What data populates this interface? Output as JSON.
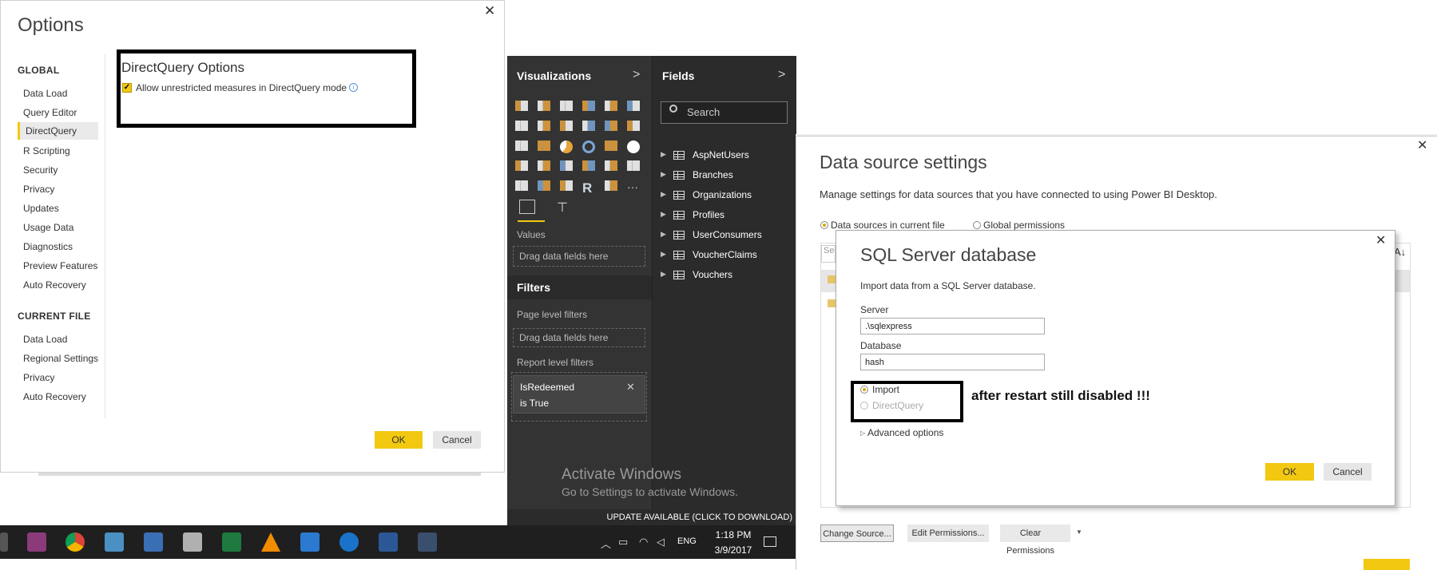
{
  "options_dialog": {
    "title": "Options",
    "global_heading": "GLOBAL",
    "global_items": [
      "Data Load",
      "Query Editor",
      "DirectQuery",
      "R Scripting",
      "Security",
      "Privacy",
      "Updates",
      "Usage Data",
      "Diagnostics",
      "Preview Features",
      "Auto Recovery"
    ],
    "active_item": "DirectQuery",
    "current_file_heading": "CURRENT FILE",
    "current_file_items": [
      "Data Load",
      "Regional Settings",
      "Privacy",
      "Auto Recovery"
    ],
    "section_title": "DirectQuery Options",
    "checkbox_label": "Allow unrestricted measures in DirectQuery mode",
    "checkbox_checked": true,
    "ok_label": "OK",
    "cancel_label": "Cancel"
  },
  "visualizations": {
    "title": "Visualizations",
    "values_label": "Values",
    "values_drop": "Drag data fields here"
  },
  "filters": {
    "title": "Filters",
    "page_level": "Page level filters",
    "page_drop": "Drag data fields here",
    "report_level": "Report level filters",
    "card_field": "IsRedeemed",
    "card_condition": "is True"
  },
  "fields": {
    "title": "Fields",
    "search_placeholder": "Search",
    "tables": [
      "AspNetUsers",
      "Branches",
      "Organizations",
      "Profiles",
      "UserConsumers",
      "VoucherClaims",
      "Vouchers"
    ]
  },
  "watermark": {
    "line1": "Activate Windows",
    "line2": "Go to Settings to activate Windows."
  },
  "update_bar": "UPDATE AVAILABLE (CLICK TO DOWNLOAD)",
  "taskbar": {
    "language": "ENG",
    "time": "1:18 PM",
    "date": "3/9/2017"
  },
  "data_source_settings": {
    "title": "Data source settings",
    "description": "Manage settings for data sources that you have connected to using Power BI Desktop.",
    "radio_current": "Data sources in current file",
    "radio_global": "Global permissions",
    "search_stub": "Se",
    "buttons": [
      "Change Source...",
      "Edit Permissions...",
      "Clear Permissions"
    ]
  },
  "sql_dialog": {
    "title": "SQL Server database",
    "description": "Import data from a SQL Server database.",
    "server_label": "Server",
    "server_value": ".\\sqlexpress",
    "database_label": "Database",
    "database_value": "hash",
    "import_label": "Import",
    "directquery_label": "DirectQuery",
    "annotation": "after restart still disabled   !!!",
    "advanced_label": "Advanced options",
    "ok_label": "OK",
    "cancel_label": "Cancel"
  },
  "colors": {
    "accent_yellow": "#f2c811",
    "pane_dark": "#333333",
    "fields_dark": "#2b2b2b"
  }
}
